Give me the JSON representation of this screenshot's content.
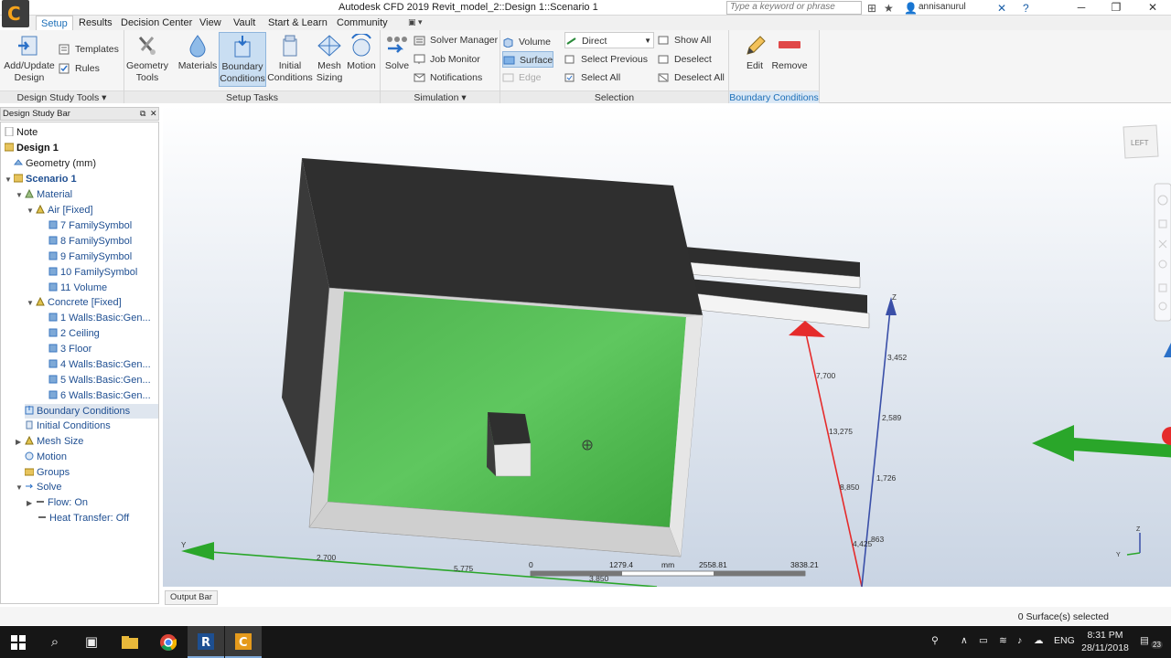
{
  "title_bar": {
    "title": "Autodesk CFD 2019   Revit_model_2::Design 1::Scenario 1",
    "search_placeholder": "Type a keyword or phrase",
    "user": "annisanurul"
  },
  "menu": {
    "tabs": [
      "Setup",
      "Results",
      "Decision Center",
      "View",
      "Vault",
      "Start & Learn",
      "Community"
    ],
    "active_tab": "Setup"
  },
  "ribbon": {
    "design_study": {
      "add_update": [
        "Add/Update",
        "Design"
      ],
      "templates": "Templates",
      "rules": "Rules",
      "label": "Design Study Tools ▾"
    },
    "setup_tasks": {
      "geometry_tools": [
        "Geometry",
        "Tools"
      ],
      "materials": "Materials",
      "boundary_conditions": [
        "Boundary",
        "Conditions"
      ],
      "initial_conditions": [
        "Initial",
        "Conditions"
      ],
      "mesh_sizing": [
        "Mesh",
        "Sizing"
      ],
      "motion": "Motion",
      "label": "Setup Tasks"
    },
    "simulation": {
      "solve": "Solve",
      "solver_manager": "Solver Manager",
      "job_monitor": "Job Monitor",
      "notifications": "Notifications",
      "label": "Simulation ▾"
    },
    "selection": {
      "volume": "Volume",
      "surface": "Surface",
      "edge": "Edge",
      "direct": "Direct",
      "select_previous": "Select Previous",
      "select_all": "Select All",
      "show_all": "Show All",
      "deselect": "Deselect",
      "deselect_all": "Deselect All",
      "label": "Selection"
    },
    "boundary_conditions": {
      "edit": "Edit",
      "remove": "Remove",
      "label": "Boundary Conditions"
    }
  },
  "design_study_bar": {
    "title": "Design Study Bar",
    "tree": [
      {
        "label": "Note",
        "level": 0
      },
      {
        "label": "Design 1",
        "level": 0
      },
      {
        "label": "Geometry (mm)",
        "level": 1
      },
      {
        "label": "Scenario 1",
        "level": 1
      },
      {
        "label": "Material",
        "level": 2
      },
      {
        "label": "Air [Fixed]",
        "level": 3
      },
      {
        "label": "7 FamilySymbol",
        "level": 4
      },
      {
        "label": "8 FamilySymbol",
        "level": 4
      },
      {
        "label": "9 FamilySymbol",
        "level": 4
      },
      {
        "label": "10 FamilySymbol",
        "level": 4
      },
      {
        "label": "11 Volume",
        "level": 4
      },
      {
        "label": "Concrete [Fixed]",
        "level": 3
      },
      {
        "label": "1 Walls:Basic:Gen...",
        "level": 4
      },
      {
        "label": "2 Ceiling",
        "level": 4
      },
      {
        "label": "3 Floor",
        "level": 4
      },
      {
        "label": "4 Walls:Basic:Gen...",
        "level": 4
      },
      {
        "label": "5 Walls:Basic:Gen...",
        "level": 4
      },
      {
        "label": "6 Walls:Basic:Gen...",
        "level": 4
      },
      {
        "label": "Boundary Conditions",
        "level": 2
      },
      {
        "label": "Initial Conditions",
        "level": 2
      },
      {
        "label": "Mesh Size",
        "level": 2
      },
      {
        "label": "Motion",
        "level": 2
      },
      {
        "label": "Groups",
        "level": 2
      },
      {
        "label": "Solve",
        "level": 2
      },
      {
        "label": "Flow: On",
        "level": 3
      },
      {
        "label": "Heat Transfer: Off",
        "level": 3
      }
    ]
  },
  "viewport": {
    "view_cube": "LEFT",
    "ruler": {
      "ticks": [
        "0",
        "1279.4",
        "2558.81",
        "3838.21"
      ],
      "unit": "mm"
    },
    "dims": [
      "2,700",
      "5,775",
      "7,700",
      "13,275",
      "8,850",
      "4,425",
      "3,452",
      "2,589",
      "1,726",
      "863",
      "3,850"
    ],
    "axis_labels": {
      "z": "Z",
      "y": "Y"
    }
  },
  "output_bar": "Output Bar",
  "status": "0 Surface(s) selected",
  "taskbar": {
    "lang": "ENG",
    "time": "8:31 PM",
    "date": "28/11/2018",
    "notif_count": "23"
  }
}
